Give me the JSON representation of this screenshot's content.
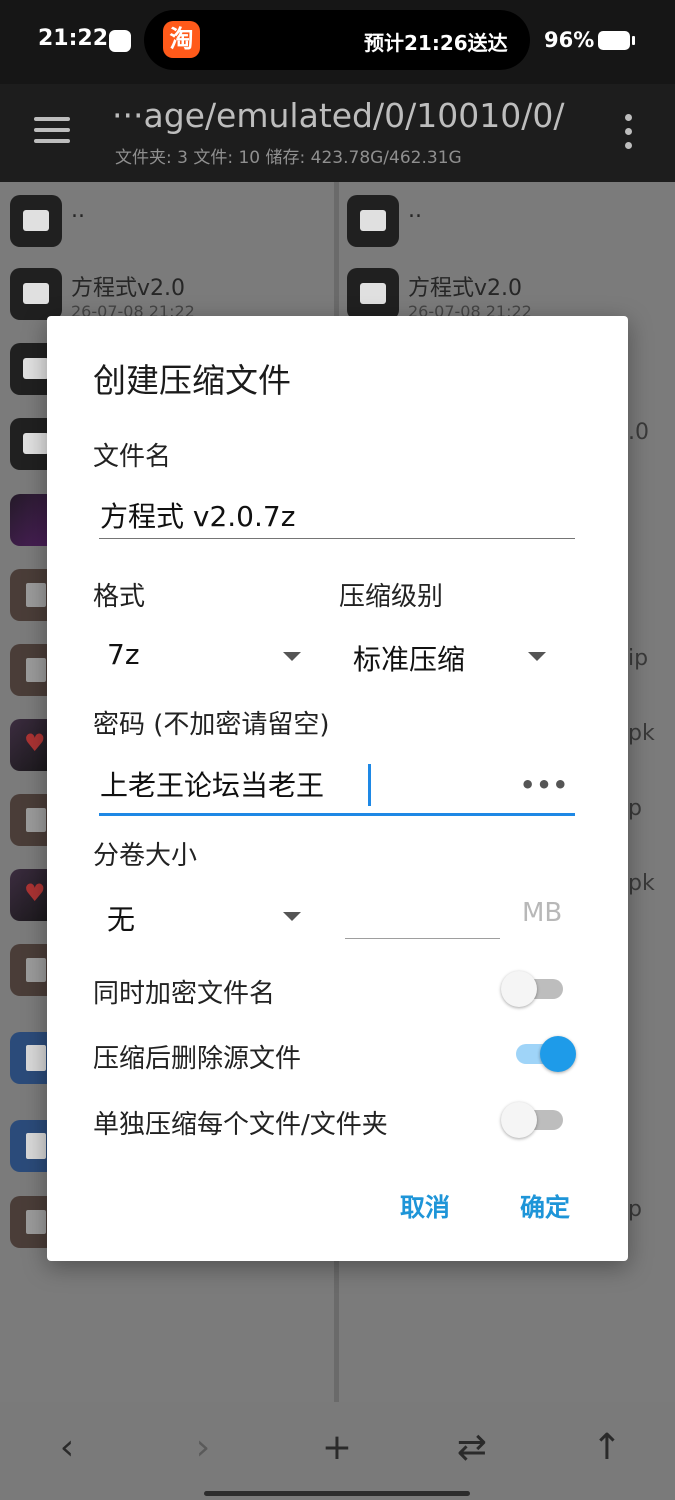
{
  "status_bar": {
    "time": "21:22",
    "live_activity": "预计21:26送达",
    "app_glyph": "淘",
    "battery": "96%"
  },
  "header": {
    "path": "···age/emulated/0/10010/0/",
    "stats": "文件夹: 3  文件: 10  储存: 423.78G/462.31G"
  },
  "left_list": [
    {
      "name": "..",
      "meta": "",
      "icon": "folder-icon"
    },
    {
      "name": "方程式v2.0",
      "meta": "26-07-08 21:22",
      "icon": "folder-icon"
    },
    {
      "name": "",
      "meta": "",
      "icon": "folder-icon"
    },
    {
      "name": "",
      "meta": "",
      "icon": "folder-icon"
    },
    {
      "name": "",
      "meta": "",
      "icon": "image-icon"
    },
    {
      "name": "",
      "meta": "",
      "icon": "archive-icon"
    },
    {
      "name": "",
      "meta": "",
      "icon": "archive-icon"
    },
    {
      "name": "",
      "meta": "",
      "icon": "apk-icon"
    },
    {
      "name": "",
      "meta": "",
      "icon": "archive-icon"
    },
    {
      "name": "",
      "meta": "",
      "icon": "apk-icon"
    },
    {
      "name": "",
      "meta": "",
      "icon": "archive-icon"
    },
    {
      "name": "",
      "meta": "",
      "icon": "document-icon"
    },
    {
      "name": "",
      "meta": "",
      "icon": "document-icon"
    },
    {
      "name": "",
      "meta": "",
      "icon": "archive-icon"
    }
  ],
  "right_list": [
    {
      "name": "..",
      "meta": "",
      "icon": "folder-icon"
    },
    {
      "name": "方程式v2.0",
      "meta": "26-07-08 21:22",
      "icon": "folder-icon"
    }
  ],
  "right_peek": [
    ".0",
    "ip",
    "pk",
    "p",
    "pk",
    "p"
  ],
  "dialog": {
    "title": "创建压缩文件",
    "filename_label": "文件名",
    "filename_value": "方程式 v2.0.7z",
    "format_label": "格式",
    "format_value": "7z",
    "level_label": "压缩级别",
    "level_value": "标准压缩",
    "password_label": "密码 (不加密请留空)",
    "password_value": "上老王论坛当老王",
    "password_toggle": "•••",
    "volume_label": "分卷大小",
    "volume_value": "无",
    "volume_unit": "MB",
    "encrypt_names_label": "同时加密文件名",
    "encrypt_names_on": false,
    "delete_source_label": "压缩后删除源文件",
    "delete_source_on": true,
    "separate_label": "单独压缩每个文件/文件夹",
    "separate_on": false,
    "cancel": "取消",
    "ok": "确定"
  },
  "bottom_bar": {
    "back": "‹",
    "forward": "›",
    "add": "+",
    "swap": "⇄",
    "up": "↑"
  },
  "colors": {
    "accent": "#1e88e5",
    "button_text": "#1e95d8",
    "switch_on": "#1e9be9"
  }
}
